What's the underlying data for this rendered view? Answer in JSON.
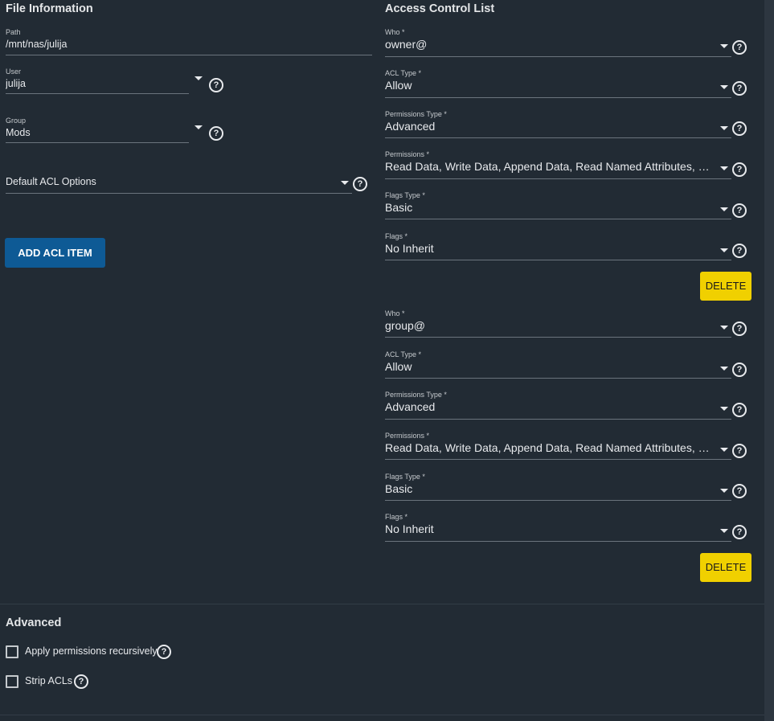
{
  "file_info": {
    "title": "File Information",
    "path": {
      "label": "Path",
      "value": "/mnt/nas/julija"
    },
    "user": {
      "label": "User",
      "value": "julija"
    },
    "group": {
      "label": "Group",
      "value": "Mods"
    },
    "default_acl": {
      "value": "Default ACL Options"
    },
    "add_button": "ADD ACL ITEM"
  },
  "acl": {
    "title": "Access Control List",
    "entries": [
      {
        "who": {
          "label": "Who *",
          "value": "owner@"
        },
        "acl_type": {
          "label": "ACL Type *",
          "value": "Allow"
        },
        "perm_type": {
          "label": "Permissions Type *",
          "value": "Advanced"
        },
        "perms": {
          "label": "Permissions *",
          "value": "Read Data, Write Data, Append Data, Read Named Attributes, Wri…"
        },
        "flags_type": {
          "label": "Flags Type *",
          "value": "Basic"
        },
        "flags": {
          "label": "Flags *",
          "value": "No Inherit"
        },
        "delete": "DELETE"
      },
      {
        "who": {
          "label": "Who *",
          "value": "group@"
        },
        "acl_type": {
          "label": "ACL Type *",
          "value": "Allow"
        },
        "perm_type": {
          "label": "Permissions Type *",
          "value": "Advanced"
        },
        "perms": {
          "label": "Permissions *",
          "value": "Read Data, Write Data, Append Data, Read Named Attributes, Wri…"
        },
        "flags_type": {
          "label": "Flags Type *",
          "value": "Basic"
        },
        "flags": {
          "label": "Flags *",
          "value": "No Inherit"
        },
        "delete": "DELETE"
      }
    ]
  },
  "advanced": {
    "title": "Advanced",
    "recursive": "Apply permissions recursively",
    "strip": "Strip ACLs"
  },
  "icons": {
    "help": "help-circle-icon",
    "dropdown": "chevron-down-icon"
  },
  "colors": {
    "background": "#222b34",
    "primary_button": "#0e5a95",
    "delete_button": "#f0d000"
  }
}
